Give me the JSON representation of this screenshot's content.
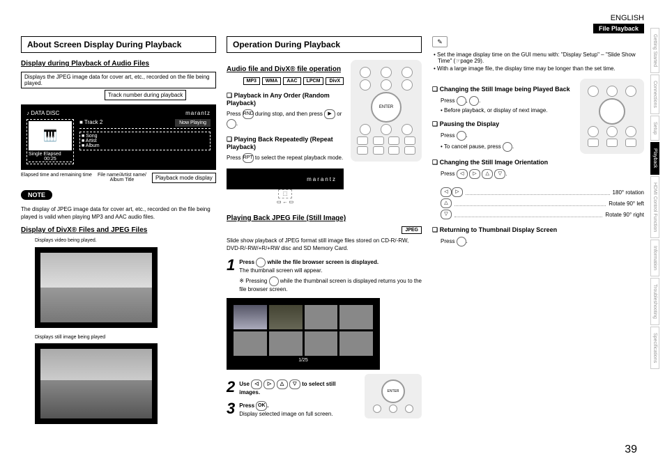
{
  "header": {
    "language": "ENGLISH",
    "breadcrumb": "File Playback"
  },
  "sideTabs": [
    "Getting Started",
    "Connections",
    "Setup",
    "Playback",
    "HDMI Control Function",
    "Information",
    "Troubleshooting",
    "Specifications"
  ],
  "activeTab": 3,
  "col1": {
    "title": "About Screen Display During Playback",
    "sub1": "Display during Playback of Audio Files",
    "callout1": "Displays the JPEG image data for cover art, etc., recorded on the file being played.",
    "callout2": "Track number during playback",
    "player": {
      "disc": "DATA DISC",
      "track": "Track 2",
      "now": "Now Playing",
      "tags": [
        "Song",
        "Artist",
        "Album"
      ],
      "elapsed": "Single Elapsed",
      "time": "00:25",
      "brand": "marantz"
    },
    "annLeft": "Elapsed time and remaining time",
    "annMid": "File name/Artist name/\nAlbum Title",
    "annRight": "Playback mode display",
    "noteLabel": "NOTE",
    "noteText": "The display of JPEG image data for cover art, etc., recorded on the file being played is valid when playing MP3 and AAC audio files.",
    "sub2": "Display of DivX® Files and JPEG Files",
    "cap1": "Displays video being played.",
    "cap2": "Displays still image being played"
  },
  "col2": {
    "title": "Operation During Playback",
    "sub1": "Audio file and DivX® file operation",
    "badges": [
      "MP3",
      "WMA",
      "AAC",
      "LPCM",
      "DivX"
    ],
    "h1": "Playback in Any Order (Random Playback)",
    "t1a": "Press ",
    "t1b": " during stop, and then press ",
    "t1c": " or ",
    "h2": "Playing Back Repeatedly (Repeat Playback)",
    "t2": "Press ",
    " t2b": " to select the repeat playback mode.",
    "brand": "marantz",
    "sub2": "Playing Back JPEG File (Still Image)",
    "badge2": "JPEG",
    "intro": "Slide show playback of JPEG format still image files stored on CD-R/-RW, DVD-R/-RW/+R/+RW disc and SD Memory Card.",
    "step1a": "Press ",
    "step1b": " while the file browser screen is displayed.",
    "step1note": "The thumbnail screen will appear.",
    "step1extra": "Pressing ",
    " step1extra2": " while the thumbnail screen is displayed returns you to the file browser screen.",
    "thumbCount": "1/25",
    "step2a": "Use ",
    "step2b": " to select still images.",
    "step3a": "Press ",
    "step3b": ".",
    "step3c": "Display selected image on full screen."
  },
  "col3": {
    "bullet1": "Set the image display time on the GUI menu with: \"Display Setup\" – \"Slide Show Time\" (☞page 29).",
    "bullet2": "With a large image file, the display time may be longer than the set time.",
    "h1": "Changing the Still Image being Played Back",
    "t1": "Press ",
    "t1b": ", ",
    "t1note": "Before playback, or display of next image.",
    "h2": "Pausing the Display",
    "t2": "Press ",
    "t2note": "To cancel pause, press ",
    "h3": "Changing the Still Image Orientation",
    "t3": "Press ",
    "orient1": "180° rotation",
    "orient2": "Rotate 90° left",
    "orient3": "Rotate 90° right",
    "h4": "Returning to Thumbnail Display Screen",
    "t4": "Press "
  },
  "pageNum": "39"
}
